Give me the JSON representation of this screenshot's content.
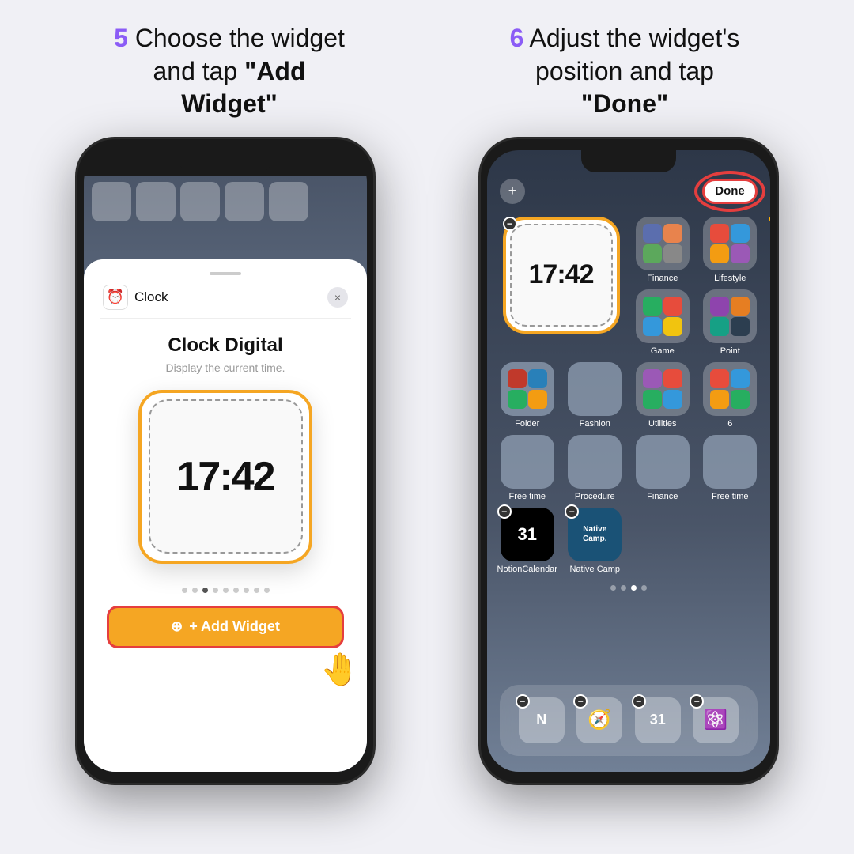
{
  "steps": [
    {
      "number": "5",
      "text1": "Choose the widget",
      "text2": "and tap ",
      "bold2": "\"Add",
      "text3": "",
      "bold3": "Widget\""
    },
    {
      "number": "6",
      "text1": "Adjust the widget's",
      "text2": "position and tap",
      "bold2": "",
      "text3": "\"Done\""
    }
  ],
  "left_phone": {
    "clock_app_name": "Clock",
    "widget_title": "Clock Digital",
    "widget_desc": "Display the current time.",
    "clock_time": "17:42",
    "add_widget_label": "+ Add Widget",
    "close_x": "×"
  },
  "right_phone": {
    "done_label": "Done",
    "clock_time": "17:42",
    "app_labels": {
      "finance": "Finance",
      "lifestyle": "Lifestyle",
      "game": "Game",
      "point": "Point",
      "folder": "Folder",
      "fashion": "Fashion",
      "utilities": "Utilities",
      "num6": "6",
      "free_time": "Free time",
      "procedure": "Procedure",
      "finance2": "Finance",
      "free_time2": "Free time",
      "notion": "NotionCalendar",
      "native_camp": "Native Camp"
    }
  },
  "colors": {
    "orange": "#f5a623",
    "red": "#e53e3e",
    "purple": "#8b5cf6",
    "bg": "#f0f0f5"
  }
}
